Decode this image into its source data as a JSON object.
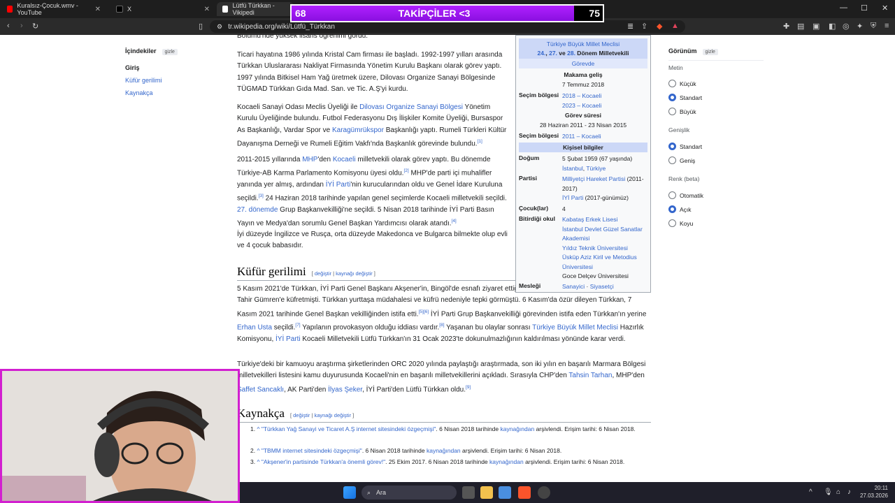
{
  "tabs": [
    {
      "title": "Kuralsız-Çocuk.wmv - YouTube",
      "icon": "youtube-icon",
      "color": "#ff0000"
    },
    {
      "title": "X",
      "icon": "x-icon",
      "color": "#000000"
    },
    {
      "title": "Lütfü Türkkan - Vikipedi",
      "icon": "wikipedia-icon",
      "color": "#ffffff"
    }
  ],
  "url": "tr.wikipedia.org/wiki/Lütfü_Türkkan",
  "overlay": {
    "left_count": "68",
    "text": "TAKİPÇİLER <3",
    "right_count": "75",
    "progress": 0.907
  },
  "toc": {
    "title": "İçindekiler",
    "hide": "gizle",
    "items": [
      "Giriş",
      "Küfür gerilimi",
      "Kaynakça"
    ]
  },
  "article": {
    "p0": "Bölümü'nde yüksek lisans öğrenimi gördü.",
    "p1": "Ticari hayatına 1986 yılında Kristal Cam firması ile başladı. 1992-1997 yılları arasında Türkkan Uluslararası Nakliyat Firmasında Yönetim Kurulu Başkanı olarak görev yaptı. 1997 yılında Bitkisel Ham Yağ üretmek üzere, Dilovası Organize Sanayi Bölgesinde TÜGMAD Türkkan Gıda Mad. San. ve Tic. A.Ş'yi kurdu.",
    "p2a": "Kocaeli Sanayi Odası Meclis Üyeliği ile ",
    "p2link1": "Dilovası Organize Sanayi Bölgesi",
    "p2b": " Yönetim Kurulu Üyeliğinde bulundu. Futbol Federasyonu Dış İlişkiler Komite Üyeliği, Bursaspor As Başkanlığı, Vardar Spor ve ",
    "p2link2": "Karagümrükspor",
    "p2c": " Başkanlığı yaptı. Rumeli Türkleri Kültür Dayanışma Derneği ve Rumeli Eğitim Vakfı'nda Başkanlık görevinde bulundu.",
    "p2ref": "[1]",
    "p3a": "2011-2015 yıllarında ",
    "p3l1": "MHP",
    "p3b": "'den ",
    "p3l2": "Kocaeli",
    "p3c": " milletvekili olarak görev yaptı. Bu dönemde Türkiye-AB Karma Parlamento Komisyonu üyesi oldu.",
    "p3r1": "[2]",
    "p3d": " MHP'de parti içi muhalifler yanında yer almış, ardından ",
    "p3l3": "İYİ Parti",
    "p3e": "'nin kurucularından oldu ve Genel İdare Kuruluna seçildi.",
    "p3r2": "[3]",
    "p3f": " 24 Haziran 2018 tarihinde yapılan genel seçimlerde Kocaeli milletvekili seçildi. ",
    "p3l4": "27. dönemde",
    "p3g": " Grup Başkanvekilliği'ne seçildi. 5 Nisan 2018 tarihinde İYİ Parti Basın Yayın ve Medya'dan sorumlu Genel Başkan Yardımcısı olarak atandı.",
    "p3r3": "[4]",
    "p4": "İyi düzeyde İngilizce ve Rusça, orta düzeyde Makedonca ve Bulgarca bilmekte olup evli ve 4 çocuk babasıdır.",
    "h_kufur": "Küfür gerilimi",
    "edit": "değiştir",
    "editsrc": "kaynağı değiştir",
    "p5a": "5 Kasım 2021'de Türkkan, İYİ Parti Genel Başkanı Akşener'in, Bingöl'de esnafı ziyaret ettiği sırada tepkisini gösteren şehit yakını Tahir Gümren'e küfretmişti. Türkkan yurttaşa müdahalesi ve küfrü nedeniyle tepki görmüştü. 6 Kasım'da özür dileyen Türkkan, 7 Kasım 2021 tarihinde Genel Başkan vekilliğinden istifa etti.",
    "p5r1": "[5][6]",
    "p5b": " İYİ Parti Grup Başkanvekilliği görevinden istifa eden Türkkan'ın yerine ",
    "p5l1": "Erhan Usta",
    "p5c": " seçildi.",
    "p5r2": "[7]",
    "p5d": " Yapılanın provokasyon olduğu iddiası vardır.",
    "p5r3": "[8]",
    "p5e": " Yaşanan bu olaylar sonrası ",
    "p5l2": "Türkiye Büyük Millet Meclisi",
    "p5f": " Hazırlık Komisyonu, ",
    "p5l3": "İYİ Parti",
    "p5g": " Kocaeli Milletvekili Lütfü Türkkan'ın 31 Ocak 2023'te dokunulmazlığının kaldırılması yönünde karar verdi.",
    "p6a": "Türkiye'deki bir kamuoyu araştırma şirketlerinden ORC 2020 yılında paylaştığı araştırmada, son iki yılın en başarılı Marmara Bölgesi milletvekilleri listesini kamu duyurusunda Kocaeli'nin en başarılı milletvekillerini açıkladı. Sırasıyla CHP'den ",
    "p6l1": "Tahsin Tarhan",
    "p6b": ", MHP'den ",
    "p6l2": "Saffet Sancaklı",
    "p6c": ", AK Parti'den ",
    "p6l3": "İlyas Şeker",
    "p6d": ", İYİ Parti'den Lütfü Türkkan oldu.",
    "p6r": "[9]",
    "h_kaynakca": "Kaynakça"
  },
  "references": [
    {
      "n": "1.",
      "title": "\"Türkkan Yağ Sanayi ve Ticaret A.Ş internet sitesindeki özgeçmişi\"",
      "rest": ". 6 Nisan 2018 tarihinde ",
      "arch": "kaynağından",
      "tail": " arşivlendi. Erişim tarihi: 6 Nisan 2018."
    },
    {
      "n": "2.",
      "title": "\"TBMM internet sitesindeki özgeçmişi\"",
      "rest": ". 6 Nisan 2018 tarihinde ",
      "arch": "kaynağından",
      "tail": " arşivlendi. Erişim tarihi: 6 Nisan 2018."
    },
    {
      "n": "3.",
      "title": "\"Akşener'in partisinde Türkkan'a önemli görev!\"",
      "rest": ". 25 Ekim 2017. 6 Nisan 2018 tarihinde ",
      "arch": "kaynağından",
      "tail": " arşivlendi. Erişim tarihi: 6 Nisan 2018."
    }
  ],
  "infobox": {
    "org": "Türkiye Büyük Millet Meclisi",
    "terms_a": "24.",
    "terms_b": "27.",
    "terms_c": "28.",
    "terms_tail": " Dönem Milletvekili",
    "and": " ve ",
    "comma": ", ",
    "gorevde": "Görevde",
    "makama_gelis": "Makama geliş",
    "makama_date": "7 Temmuz 2018",
    "secim_label": "Seçim bölgesi",
    "secim1": "2018 – Kocaeli",
    "secim2": "2023 – Kocaeli",
    "gorev_suresi": "Görev süresi",
    "gorev_dates": "28 Haziran 2011 - 23 Nisan 2015",
    "secim3": "2011 – Kocaeli",
    "kisisel": "Kişisel bilgiler",
    "dogum_label": "Doğum",
    "dogum_val": "5 Şubat 1959 (67 yaşında)",
    "dogum_place1": "İstanbul",
    "dogum_place2": "Türkiye",
    "partisi_label": "Partisi",
    "parti1": "Milliyetçi Hareket Partisi",
    "parti1_years": " (2011-2017)",
    "parti2": "İYİ Parti",
    "parti2_years": " (2017-günümüz)",
    "cocuk_label": "Çocuk(lar)",
    "cocuk_val": "4",
    "okul_label": "Bitirdiği okul",
    "okul1": "Kabataş Erkek Lisesi",
    "okul2": "İstanbul Devlet Güzel Sanatlar Akademisi",
    "okul3": "Yıldız Teknik Üniversitesi",
    "okul4": "Üsküp Aziz Kiril ve Metodius Üniversitesi",
    "okul5": "Goce Delçev Üniversitesi",
    "meslek_label": "Mesleği",
    "meslek1": "Sanayici",
    "meslek_sep": " · ",
    "meslek2": "Siyasetçi"
  },
  "appearance": {
    "title": "Görünüm",
    "hide": "gizle",
    "text_label": "Metin",
    "text_options": [
      "Küçük",
      "Standart",
      "Büyük"
    ],
    "width_label": "Genişlik",
    "width_options": [
      "Standart",
      "Geniş"
    ],
    "color_label": "Renk (beta)",
    "color_options": [
      "Otomatik",
      "Açık",
      "Koyu"
    ]
  },
  "taskbar": {
    "search": "Ara",
    "time": "20:11",
    "date": "27.03.2026"
  }
}
